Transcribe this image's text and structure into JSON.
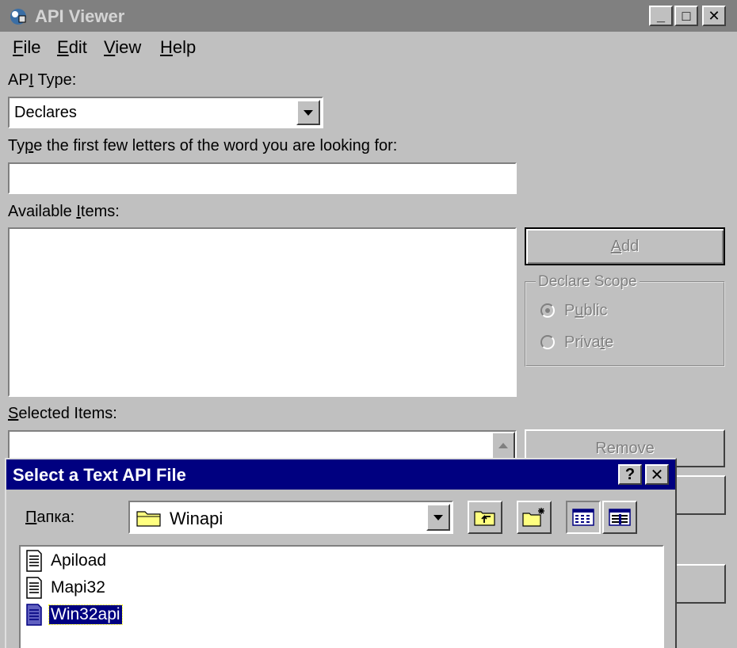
{
  "window": {
    "title": "API Viewer",
    "controls": {
      "minimize": "_",
      "maximize": "□",
      "close": "✕"
    }
  },
  "menu": {
    "items": [
      {
        "label": "File",
        "underline": "F",
        "rest": "ile"
      },
      {
        "label": "Edit",
        "underline": "E",
        "rest": "dit"
      },
      {
        "label": "View",
        "underline": "V",
        "rest": "iew"
      },
      {
        "label": "Help",
        "underline": "H",
        "rest": "elp"
      }
    ]
  },
  "api_type": {
    "label_pre": "AP",
    "label_u": "I",
    "label_post": " Type:",
    "selected": "Declares"
  },
  "search": {
    "label_pre": "Ty",
    "label_u": "p",
    "label_post": "e the first few letters of the word you are looking for:",
    "value": ""
  },
  "available": {
    "label_pre": "Available ",
    "label_u": "I",
    "label_post": "tems:",
    "items": []
  },
  "add_button": {
    "pre": "",
    "u": "A",
    "post": "dd"
  },
  "declare_scope": {
    "legend": "Declare Scope",
    "public": {
      "pre": "P",
      "u": "u",
      "post": "blic",
      "checked": true
    },
    "private": {
      "pre": "Priva",
      "u": "t",
      "post": "e",
      "checked": false
    }
  },
  "selected": {
    "label_pre": "",
    "label_u": "S",
    "label_post": "elected Items:"
  },
  "remove_button": {
    "label": "Remove"
  },
  "dialog": {
    "title": "Select a Text API File",
    "help": "?",
    "close": "✕",
    "folder_label_pre": "",
    "folder_label_u": "П",
    "folder_label_post": "апка:",
    "folder_value": "Winapi",
    "files": [
      {
        "name": "Apiload",
        "selected": false
      },
      {
        "name": "Mapi32",
        "selected": false
      },
      {
        "name": "Win32api",
        "selected": true
      }
    ]
  },
  "colors": {
    "face": "#c0c0c0",
    "dialog_title": "#000080",
    "inactive_title": "#808080"
  }
}
